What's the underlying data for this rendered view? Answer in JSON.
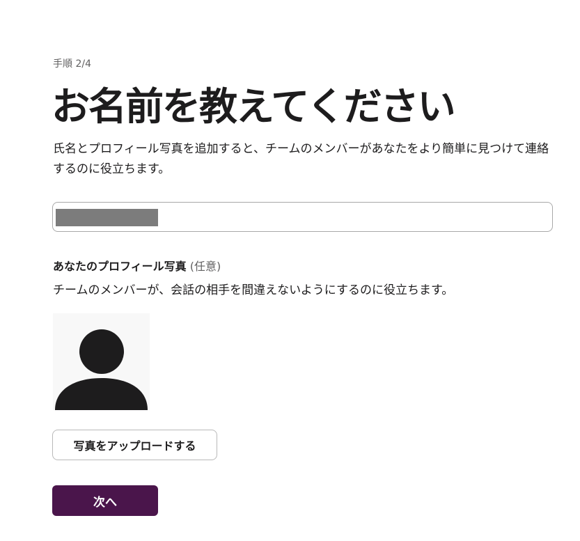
{
  "step": {
    "label": "手順 2/4"
  },
  "heading": {
    "title": "お名前を教えてください",
    "description": "氏名とプロフィール写真を追加すると、チームのメンバーがあなたをより簡単に見つけて連絡するのに役立ちます。"
  },
  "name_field": {
    "value": ""
  },
  "profile_photo": {
    "label": "あなたのプロフィール写真",
    "optional": "(任意)",
    "help": "チームのメンバーが、会話の相手を間違えないようにするのに役立ちます。",
    "avatar_icon": "default-user-silhouette-icon"
  },
  "buttons": {
    "upload_label": "写真をアップロードする",
    "next_label": "次へ"
  },
  "colors": {
    "primary": "#4a154b",
    "text": "#1d1c1d",
    "muted": "#616061",
    "border": "#a8a8a8"
  }
}
